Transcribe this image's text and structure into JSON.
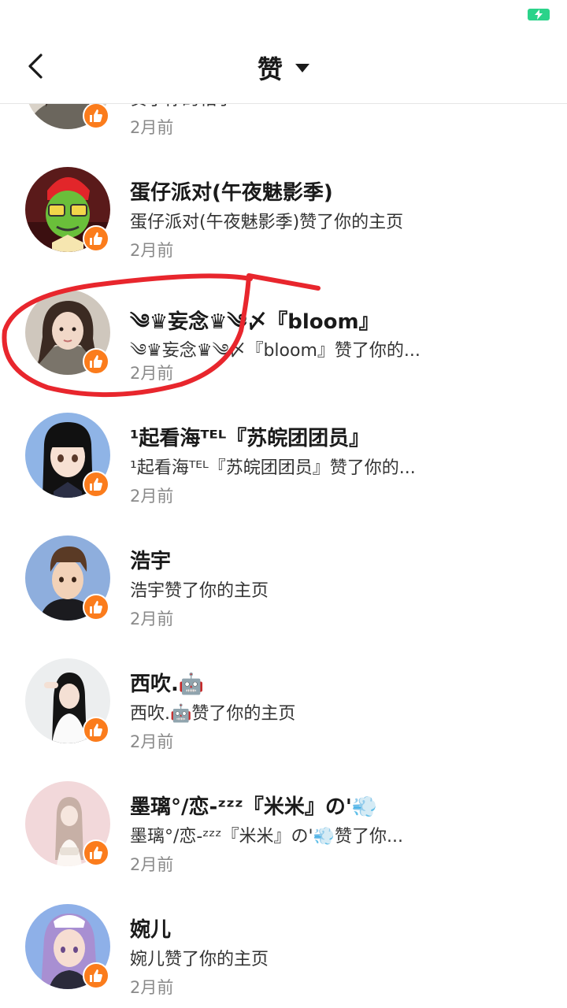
{
  "header": {
    "title": "赞",
    "back_icon": "chevron-left-icon",
    "dropdown_icon": "caret-down-icon"
  },
  "status": {
    "battery_icon": "battery-charging-icon",
    "battery_color": "#2bd38a"
  },
  "accent": {
    "like_badge_color": "#fb7c1c",
    "annotation_color": "#e8262d"
  },
  "likes": [
    {
      "name": "",
      "desc": "赞了你的相子",
      "time": "2月前",
      "avatar": "girl-gray-avatar"
    },
    {
      "name": "蛋仔派对(午夜魅影季)",
      "desc": "蛋仔派对(午夜魅影季)赞了你的主页",
      "time": "2月前",
      "avatar": "green-character-avatar"
    },
    {
      "name": "༄♛妄念♛༄〆『bloom』",
      "desc": "༄♛妄念♛༄〆『bloom』赞了你的...",
      "time": "2月前",
      "avatar": "girl-photo-avatar"
    },
    {
      "name": "¹起看海ᵀᴱᴸ『苏皖团团员』",
      "desc": "¹起看海ᵀᴱᴸ『苏皖团团员』赞了你的...",
      "time": "2月前",
      "avatar": "anime-girl-avatar"
    },
    {
      "name": "浩宇",
      "desc": "浩宇赞了你的主页",
      "time": "2月前",
      "avatar": "anime-boy-avatar"
    },
    {
      "name": "西吹.🤖",
      "desc": "西吹.🤖赞了你的主页",
      "time": "2月前",
      "avatar": "dark-hair-girl-avatar"
    },
    {
      "name": "墨璃°/恋-ᶻᶻᶻ『米米』の'💨",
      "desc": "墨璃°/恋-ᶻᶻᶻ『米米』の'💨赞了你...",
      "time": "2月前",
      "avatar": "pink-girl-avatar"
    },
    {
      "name": "婉儿",
      "desc": "婉儿赞了你的主页",
      "time": "2月前",
      "avatar": "maid-girl-avatar"
    }
  ]
}
